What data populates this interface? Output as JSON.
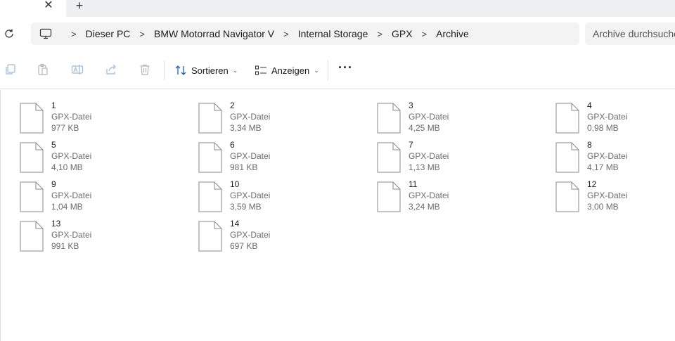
{
  "tabs": {
    "close_glyph": "✕",
    "new_glyph": "+"
  },
  "address": {
    "crumbs": [
      "Dieser PC",
      "BMW Motorrad Navigator V",
      "Internal Storage",
      "GPX",
      "Archive"
    ],
    "separator": ">"
  },
  "search": {
    "placeholder": "Archive durchsuchen"
  },
  "toolbar": {
    "sort_label": "Sortieren",
    "view_label": "Anzeigen",
    "more_label": "···",
    "chevron": "⌄"
  },
  "files": [
    {
      "name": "1",
      "type": "GPX-Datei",
      "size": "977 KB"
    },
    {
      "name": "2",
      "type": "GPX-Datei",
      "size": "3,34 MB"
    },
    {
      "name": "3",
      "type": "GPX-Datei",
      "size": "4,25 MB"
    },
    {
      "name": "4",
      "type": "GPX-Datei",
      "size": "0,98 MB"
    },
    {
      "name": "5",
      "type": "GPX-Datei",
      "size": "4,10 MB"
    },
    {
      "name": "6",
      "type": "GPX-Datei",
      "size": "981 KB"
    },
    {
      "name": "7",
      "type": "GPX-Datei",
      "size": "1,13 MB"
    },
    {
      "name": "8",
      "type": "GPX-Datei",
      "size": "4,17 MB"
    },
    {
      "name": "9",
      "type": "GPX-Datei",
      "size": "1,04 MB"
    },
    {
      "name": "10",
      "type": "GPX-Datei",
      "size": "3,59 MB"
    },
    {
      "name": "11",
      "type": "GPX-Datei",
      "size": "3,24 MB"
    },
    {
      "name": "12",
      "type": "GPX-Datei",
      "size": "3,00 MB"
    },
    {
      "name": "13",
      "type": "GPX-Datei",
      "size": "991 KB"
    },
    {
      "name": "14",
      "type": "GPX-Datei",
      "size": "697 KB"
    }
  ]
}
